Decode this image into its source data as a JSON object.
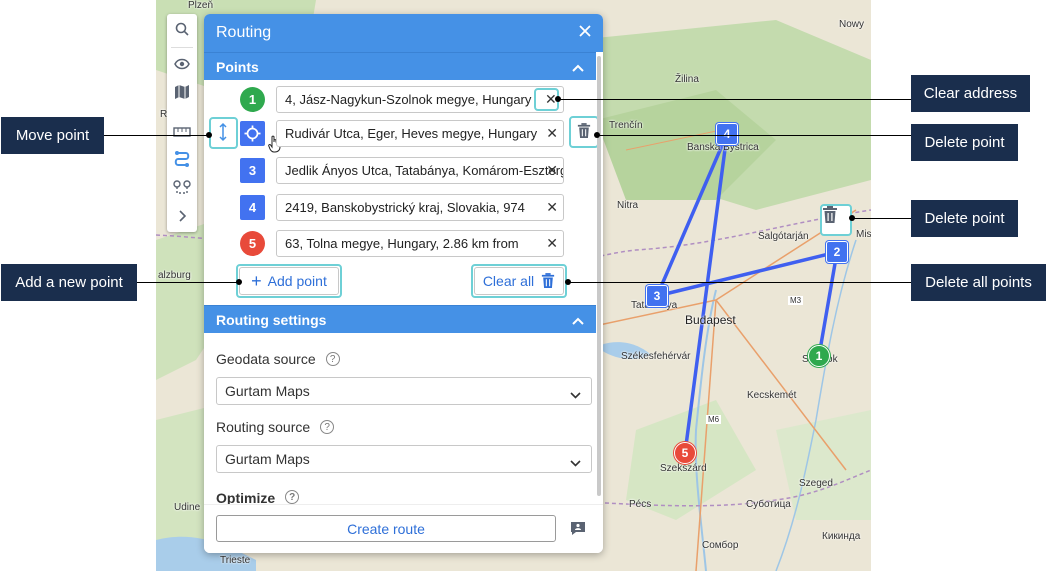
{
  "map": {
    "cities": [
      {
        "name": "Plzeň",
        "big": false
      },
      {
        "name": "Nowy",
        "big": false
      },
      {
        "name": "Žilina",
        "big": false
      },
      {
        "name": "Trenčín",
        "big": false
      },
      {
        "name": "Banská Bystrica",
        "big": false
      },
      {
        "name": "Nitra",
        "big": false
      },
      {
        "name": "Salgótarján",
        "big": false
      },
      {
        "name": "Mis",
        "big": false
      },
      {
        "name": "Tatabánya",
        "big": false
      },
      {
        "name": "Budapest",
        "big": true
      },
      {
        "name": "Székesfehérvár",
        "big": false
      },
      {
        "name": "Szolnok",
        "big": false
      },
      {
        "name": "Kecskemét",
        "big": false
      },
      {
        "name": "Szekszárd",
        "big": false
      },
      {
        "name": "Szeged",
        "big": false
      },
      {
        "name": "Pécs",
        "big": false
      },
      {
        "name": "Суботица",
        "big": false
      },
      {
        "name": "Сомбор",
        "big": false
      },
      {
        "name": "Кикинда",
        "big": false
      },
      {
        "name": "Udine",
        "big": false
      },
      {
        "name": "Trieste",
        "big": false
      },
      {
        "name": "Regen",
        "big": false
      },
      {
        "name": "alzburg",
        "big": false
      },
      {
        "name": "M3",
        "big": false
      },
      {
        "name": "M6",
        "big": false
      }
    ],
    "markers": [
      "1",
      "2",
      "3",
      "4",
      "5"
    ]
  },
  "panel": {
    "title": "Routing",
    "points_title": "Points",
    "points": [
      {
        "num": "1",
        "address": "4, Jász-Nagykun-Szolnok megye, Hungary"
      },
      {
        "num": "2",
        "address": "Rudivár Utca, Eger, Heves megye, Hungary"
      },
      {
        "num": "3",
        "address": "Jedlik Ányos Utca, Tatabánya, Komárom-Esztergom"
      },
      {
        "num": "4",
        "address": "2419, Banskobystrický kraj, Slovakia, 974"
      },
      {
        "num": "5",
        "address": "63, Tolna megye, Hungary, 2.86 km from"
      }
    ],
    "add_point_label": "Add point",
    "clear_all_label": "Clear all",
    "settings_title": "Routing settings",
    "geodata_label": "Geodata source",
    "geodata_value": "Gurtam Maps",
    "routing_label": "Routing source",
    "routing_value": "Gurtam Maps",
    "optimize_label": "Optimize",
    "create_route_label": "Create route"
  },
  "callouts": {
    "clear_address": "Clear address",
    "move_point": "Move point",
    "delete_point_1": "Delete point",
    "delete_point_2": "Delete point",
    "add_new_point": "Add a new point",
    "delete_all_points": "Delete all points"
  },
  "colors": {
    "accent": "#4591e6",
    "route_line": "#3f5ff0",
    "marker_blue": "#4272f0",
    "marker_green": "#2fa94e",
    "marker_red": "#e84a3a",
    "callout_bg": "#1a2e4d",
    "highlight": "#6ed0d6"
  }
}
